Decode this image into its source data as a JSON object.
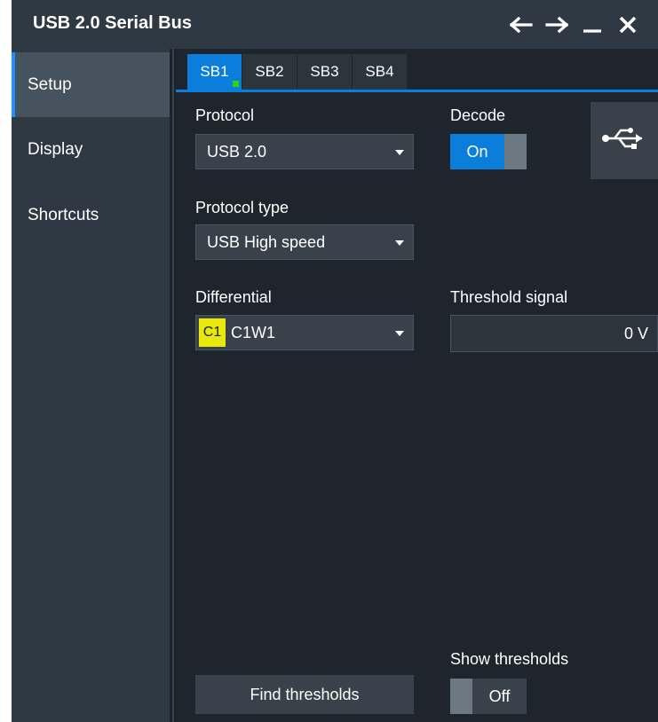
{
  "window": {
    "title": "USB 2.0 Serial Bus",
    "controls": [
      "back-arrow-icon",
      "forward-arrow-icon",
      "minimize-icon",
      "close-icon"
    ]
  },
  "sidebar": {
    "items": [
      {
        "label": "Setup",
        "active": true
      },
      {
        "label": "Display",
        "active": false
      },
      {
        "label": "Shortcuts",
        "active": false
      }
    ]
  },
  "tabs": [
    {
      "label": "SB1",
      "active": true
    },
    {
      "label": "SB2",
      "active": false
    },
    {
      "label": "SB3",
      "active": false
    },
    {
      "label": "SB4",
      "active": false
    }
  ],
  "setup": {
    "protocol_label": "Protocol",
    "protocol_value": "USB 2.0",
    "decode_label": "Decode",
    "decode_value": "On",
    "protocol_type_label": "Protocol type",
    "protocol_type_value": "USB High speed",
    "differential_label": "Differential",
    "differential_channel": "C1",
    "differential_value": "C1W1",
    "threshold_label": "Threshold signal",
    "threshold_value": "0 V",
    "show_thresholds_label": "Show thresholds",
    "show_thresholds_value": "Off",
    "find_thresholds_label": "Find thresholds",
    "usb_icon": "usb-icon"
  },
  "colors": {
    "accent": "#0b7ddb",
    "active_indicator": "#29d60c",
    "channel_badge": "#e8e80a",
    "background": "#2f3943",
    "panel": "#1e252c"
  }
}
